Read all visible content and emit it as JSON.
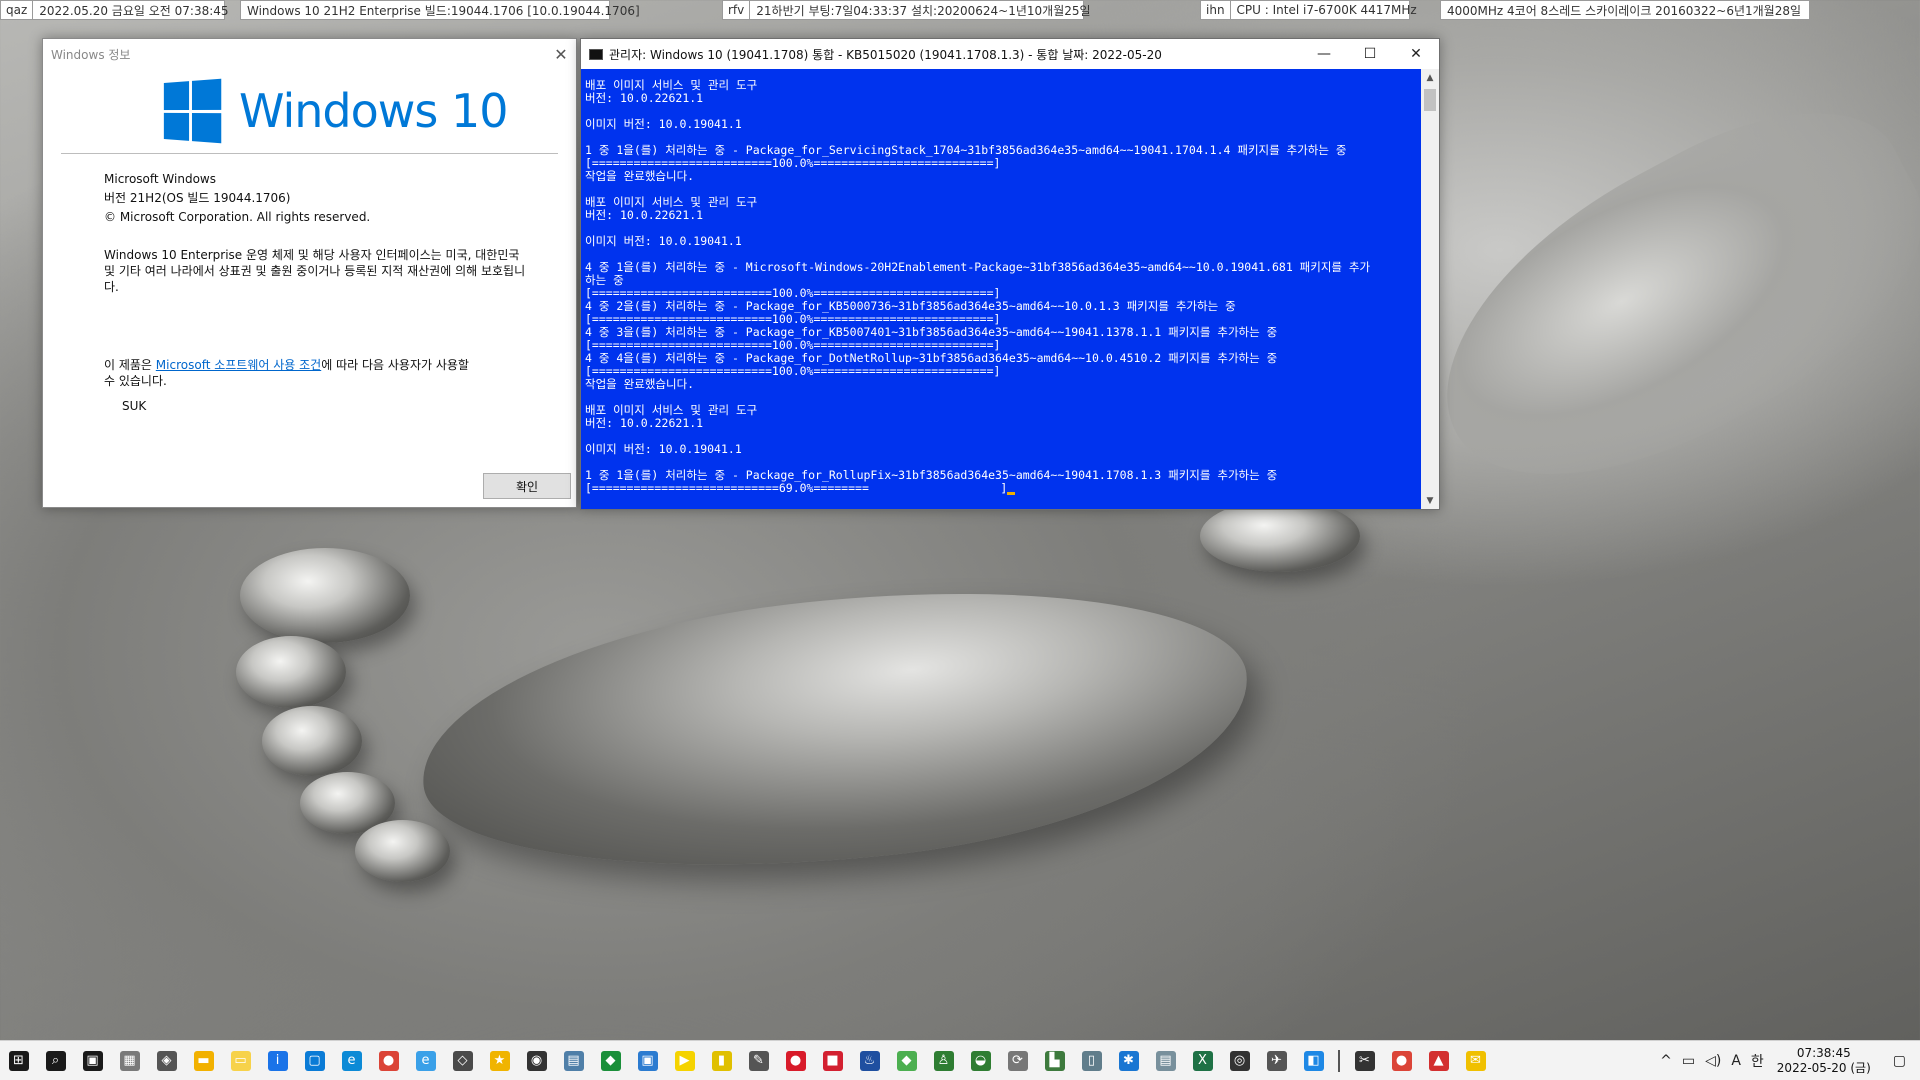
{
  "infobars": [
    {
      "tag": "qaz",
      "value": "2022.05.20 금요일 오전 07:38:45"
    },
    {
      "tag": "",
      "value": "Windows 10 21H2 Enterprise 빌드:19044.1706 [10.0.19044.1706]"
    },
    {
      "tag": "rfv",
      "value": "21하반기 부팅:7일04:33:37 설치:20200624~1년10개월25일"
    },
    {
      "tag": "ihn",
      "value": "CPU : Intel i7-6700K 4417MHz"
    },
    {
      "tag": "",
      "value": "4000MHz 4코어 8스레드 스카이레이크 20160322~6년1개월28일"
    }
  ],
  "about": {
    "title": "Windows 정보",
    "logo_text": "Windows 10",
    "product": "Microsoft Windows",
    "version": "버전 21H2(OS 빌드 19044.1706)",
    "copyright": "© Microsoft Corporation. All rights reserved.",
    "legal": "Windows 10 Enterprise 운영 체제 및 해당 사용자 인터페이스는 미국, 대한민국 및 기타 여러 나라에서 상표권 및 출원 중이거나 등록된 지적 재산권에 의해 보호됩니다.",
    "license_prefix": "이 제품은 ",
    "license_link": "Microsoft 소프트웨어 사용 조건",
    "license_suffix": "에 따라 다음 사용자가 사용할 수 있습니다.",
    "user": "SUK",
    "ok_label": "확인"
  },
  "cmd": {
    "title": "관리자:  Windows 10 (19041.1708) 통합 - KB5015020 (19041.1708.1.3) - 통합 날짜: 2022-05-20",
    "lines": [
      "배포 이미지 서비스 및 관리 도구",
      "버전: 10.0.22621.1",
      "",
      "이미지 버전: 10.0.19041.1",
      "",
      "1 중 1을(를) 처리하는 중 - Package_for_ServicingStack_1704~31bf3856ad364e35~amd64~~19041.1704.1.4 패키지를 추가하는 중",
      "[==========================100.0%==========================]",
      "작업을 완료했습니다.",
      "",
      "배포 이미지 서비스 및 관리 도구",
      "버전: 10.0.22621.1",
      "",
      "이미지 버전: 10.0.19041.1",
      "",
      "4 중 1을(를) 처리하는 중 - Microsoft-Windows-20H2Enablement-Package~31bf3856ad364e35~amd64~~10.0.19041.681 패키지를 추가",
      "하는 중",
      "[==========================100.0%==========================]",
      "4 중 2을(를) 처리하는 중 - Package_for_KB5000736~31bf3856ad364e35~amd64~~10.0.1.3 패키지를 추가하는 중",
      "[==========================100.0%==========================]",
      "4 중 3을(를) 처리하는 중 - Package_for_KB5007401~31bf3856ad364e35~amd64~~19041.1378.1.1 패키지를 추가하는 중",
      "[==========================100.0%==========================]",
      "4 중 4을(를) 처리하는 중 - Package_for_DotNetRollup~31bf3856ad364e35~amd64~~10.0.4510.2 패키지를 추가하는 중",
      "[==========================100.0%==========================]",
      "작업을 완료했습니다.",
      "",
      "배포 이미지 서비스 및 관리 도구",
      "버전: 10.0.22621.1",
      "",
      "이미지 버전: 10.0.19041.1",
      "",
      "1 중 1을(를) 처리하는 중 - Package_for_RollupFix~31bf3856ad364e35~amd64~~19041.1708.1.3 패키지를 추가하는 중",
      "[===========================69.0%========                   ]"
    ]
  },
  "taskbar": {
    "icons": [
      {
        "name": "start-icon",
        "glyph": "⊞",
        "color": "#1a1a1a"
      },
      {
        "name": "search-icon",
        "glyph": "⌕",
        "color": "#1a1a1a"
      },
      {
        "name": "task-view-icon",
        "glyph": "▣",
        "color": "#1a1a1a"
      },
      {
        "name": "app-icon-1",
        "glyph": "▦",
        "color": "#7a7a7a"
      },
      {
        "name": "app-icon-2",
        "glyph": "◈",
        "color": "#555555"
      },
      {
        "name": "file-explorer-icon",
        "glyph": "▬",
        "color": "#f2b100"
      },
      {
        "name": "notes-icon",
        "glyph": "▭",
        "color": "#f7d24a"
      },
      {
        "name": "info-icon",
        "glyph": "i",
        "color": "#1a73e8"
      },
      {
        "name": "app-icon-3",
        "glyph": "▢",
        "color": "#0a7bd6"
      },
      {
        "name": "edge-icon",
        "glyph": "e",
        "color": "#0c8ad6"
      },
      {
        "name": "chrome-icon",
        "glyph": "●",
        "color": "#db4437"
      },
      {
        "name": "ie-icon",
        "glyph": "e",
        "color": "#3aa0e8"
      },
      {
        "name": "cube-icon",
        "glyph": "◇",
        "color": "#4a4a4a"
      },
      {
        "name": "star-icon",
        "glyph": "★",
        "color": "#f0b400"
      },
      {
        "name": "app-icon-4",
        "glyph": "◉",
        "color": "#333333"
      },
      {
        "name": "app-icon-5",
        "glyph": "▤",
        "color": "#4f7fa8"
      },
      {
        "name": "shield-icon",
        "glyph": "◆",
        "color": "#1b8f3a"
      },
      {
        "name": "app-icon-6",
        "glyph": "▣",
        "color": "#2b7bd0"
      },
      {
        "name": "player-icon",
        "glyph": "▶",
        "color": "#f5d300"
      },
      {
        "name": "app-icon-7",
        "glyph": "▮",
        "color": "#e0c000"
      },
      {
        "name": "app-icon-8",
        "glyph": "✎",
        "color": "#555555"
      },
      {
        "name": "media-icon",
        "glyph": "●",
        "color": "#d81b2a"
      },
      {
        "name": "app-icon-9",
        "glyph": "■",
        "color": "#d32030"
      },
      {
        "name": "app-icon-10",
        "glyph": "♨",
        "color": "#1f4fa0"
      },
      {
        "name": "app-icon-11",
        "glyph": "◆",
        "color": "#4caf50"
      },
      {
        "name": "app-icon-12",
        "glyph": "♙",
        "color": "#2e7d32"
      },
      {
        "name": "app-icon-13",
        "glyph": "◒",
        "color": "#2f7d32"
      },
      {
        "name": "sync-icon",
        "glyph": "⟳",
        "color": "#777777"
      },
      {
        "name": "app-icon-14",
        "glyph": "▙",
        "color": "#3d7a3d"
      },
      {
        "name": "app-icon-15",
        "glyph": "▯",
        "color": "#607d8b"
      },
      {
        "name": "app-icon-16",
        "glyph": "✱",
        "color": "#1976d2"
      },
      {
        "name": "app-icon-17",
        "glyph": "▤",
        "color": "#78909c"
      },
      {
        "name": "excel-icon",
        "glyph": "X",
        "color": "#1e7145"
      },
      {
        "name": "app-icon-18",
        "glyph": "◎",
        "color": "#333333"
      },
      {
        "name": "app-icon-19",
        "glyph": "✈",
        "color": "#555555"
      },
      {
        "name": "app-icon-20",
        "glyph": "◧",
        "color": "#1e88e5"
      }
    ],
    "pinned_right": [
      {
        "name": "scissors-icon",
        "glyph": "✂",
        "color": "#333333"
      },
      {
        "name": "chrome-icon-2",
        "glyph": "●",
        "color": "#db4437"
      },
      {
        "name": "app-icon-21",
        "glyph": "▲",
        "color": "#d32f2f"
      },
      {
        "name": "app-icon-22",
        "glyph": "✉",
        "color": "#f0c000"
      }
    ],
    "tray": {
      "chevron": "^",
      "network": "▭",
      "volume": "◁)",
      "input_mode": "A",
      "ime": "한",
      "time": "07:38:45",
      "date": "2022-05-20 (금)",
      "notifications": "▢"
    }
  },
  "colors": {
    "cmd_background": "#0033ee",
    "windows_blue": "#0078d7",
    "link": "#0066cc"
  }
}
